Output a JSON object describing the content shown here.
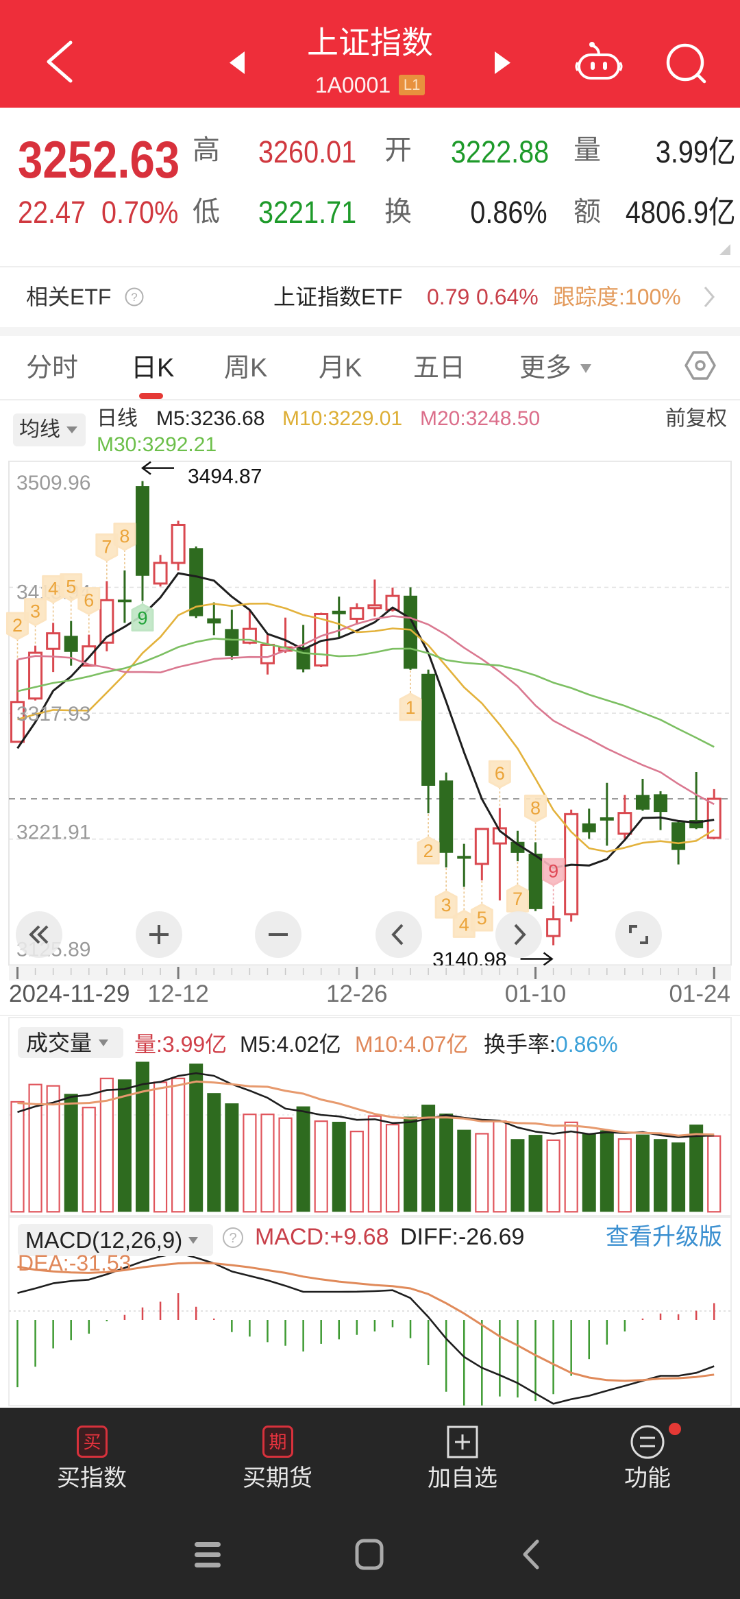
{
  "header": {
    "title": "上证指数",
    "code": "1A0001",
    "level_badge": "L1"
  },
  "quote": {
    "price": "3252.63",
    "change": "22.47",
    "change_pct": "0.70%",
    "high_label": "高",
    "high": "3260.01",
    "open_label": "开",
    "open": "3222.88",
    "volume_label": "量",
    "volume": "3.99亿",
    "low_label": "低",
    "low": "3221.71",
    "turnover_label": "换",
    "turnover": "0.86%",
    "amount_label": "额",
    "amount": "4806.9亿"
  },
  "etf": {
    "section_label": "相关ETF",
    "name": "上证指数ETF",
    "price": "0.79",
    "change_pct": "0.64%",
    "tracking": "跟踪度:100%"
  },
  "tabs": {
    "items": [
      {
        "label": "分时",
        "active": false
      },
      {
        "label": "日K",
        "active": true
      },
      {
        "label": "周K",
        "active": false
      },
      {
        "label": "月K",
        "active": false
      },
      {
        "label": "五日",
        "active": false
      },
      {
        "label": "更多",
        "active": false
      }
    ]
  },
  "kline_legend": {
    "indicator_select": "均线",
    "period": "日线",
    "ma5": "M5:3236.68",
    "ma10": "M10:3229.01",
    "ma20": "M20:3248.50",
    "ma30": "M30:3292.21",
    "adjust_mode": "前复权"
  },
  "chart_controls": [
    {
      "icon": "double-chevron-left-icon",
      "action": "jump-to-start"
    },
    {
      "icon": "plus-icon",
      "action": "zoom-in"
    },
    {
      "icon": "minus-icon",
      "action": "zoom-out"
    },
    {
      "icon": "chevron-left-icon",
      "action": "scroll-left"
    },
    {
      "icon": "chevron-right-icon",
      "action": "scroll-right"
    },
    {
      "icon": "fullscreen-icon",
      "action": "fullscreen"
    }
  ],
  "volume_legend": {
    "select": "成交量",
    "volume": "量:3.99亿",
    "ma5": "M5:4.02亿",
    "ma10": "M10:4.07亿",
    "turnover_label": "换手率:",
    "turnover_value": "0.86%"
  },
  "macd_legend": {
    "select": "MACD(12,26,9)",
    "macd": "MACD:+9.68",
    "diff": "DIFF:-26.69",
    "dea": "DEA:-31.53",
    "upgrade_link": "查看升级版"
  },
  "bottom_nav": [
    {
      "label": "买指数",
      "glyph": "买",
      "icon": "buy-index-icon"
    },
    {
      "label": "买期货",
      "glyph": "期",
      "icon": "buy-futures-icon"
    },
    {
      "label": "加自选",
      "icon": "add-watchlist-icon"
    },
    {
      "label": "功能",
      "icon": "functions-menu-icon",
      "badge_dot": true
    }
  ],
  "system_nav": [
    "recents-icon",
    "home-icon",
    "back-icon"
  ],
  "colors": {
    "brand_red": "#EE2E3A",
    "up": "#D9484F",
    "down": "#2E6B1F",
    "up_text": "#D0383F",
    "down_text": "#1E9A2A",
    "link_blue": "#3A8FD0",
    "tracking_orange": "#E39A5B"
  },
  "chart_data": [
    {
      "id": "kline",
      "type": "bar",
      "variant": "candlestick",
      "title": "日线",
      "xlabel": "",
      "ylabel": "",
      "ylim": [
        3125.89,
        3509.96
      ],
      "y_ticks": [
        3509.96,
        3413.94,
        3317.93,
        3221.91,
        3125.89
      ],
      "x_tick_labels": [
        {
          "index": 0,
          "label": "2024-11-29"
        },
        {
          "index": 9,
          "label": "12-12"
        },
        {
          "index": 19,
          "label": "12-26"
        },
        {
          "index": 29,
          "label": "01-10"
        },
        {
          "index": 39,
          "label": "01-24"
        }
      ],
      "grid": true,
      "last_price": 3252.63,
      "ohlc_fields": [
        "open",
        "high",
        "low",
        "close"
      ],
      "ohlc": [
        [
          3296.1,
          3358.7,
          3295.5,
          3326.46
        ],
        [
          3329.1,
          3369.4,
          3327.6,
          3363.98
        ],
        [
          3367.0,
          3386.8,
          3349.3,
          3378.81
        ],
        [
          3376.9,
          3388.2,
          3354.2,
          3364.65
        ],
        [
          3354.2,
          3377.8,
          3353.5,
          3368.86
        ],
        [
          3371.7,
          3418.6,
          3365.1,
          3404.08
        ],
        [
          3404.5,
          3426.8,
          3386.8,
          3402.53
        ],
        [
          3491.0,
          3494.87,
          3403.5,
          3422.66
        ],
        [
          3416.8,
          3438.6,
          3414.5,
          3432.49
        ],
        [
          3432.5,
          3464.6,
          3426.8,
          3461.5
        ],
        [
          3443.8,
          3445.0,
          3390.5,
          3391.88
        ],
        [
          3390.2,
          3402.4,
          3377.4,
          3386.33
        ],
        [
          3382.1,
          3396.8,
          3358.7,
          3361.49
        ],
        [
          3371.7,
          3396.8,
          3370.5,
          3382.21
        ],
        [
          3356.0,
          3378.6,
          3347.4,
          3370.03
        ],
        [
          3365.6,
          3390.8,
          3363.9,
          3368.07
        ],
        [
          3368.2,
          3385.2,
          3349.1,
          3351.26
        ],
        [
          3354.3,
          3394.5,
          3353.0,
          3393.53
        ],
        [
          3396.0,
          3406.8,
          3376.0,
          3393.35
        ],
        [
          3389.9,
          3401.7,
          3385.5,
          3398.08
        ],
        [
          3398.1,
          3419.8,
          3391.6,
          3400.14
        ],
        [
          3396.8,
          3413.7,
          3395.5,
          3407.33
        ],
        [
          3407.5,
          3413.9,
          3351.0,
          3351.76
        ],
        [
          3347.9,
          3351.1,
          3241.6,
          3262.56
        ],
        [
          3266.6,
          3272.7,
          3200.3,
          3211.43
        ],
        [
          3209.1,
          3218.3,
          3185.5,
          3206.92
        ],
        [
          3203.0,
          3230.0,
          3190.4,
          3229.64
        ],
        [
          3218.6,
          3245.7,
          3175.1,
          3230.17
        ],
        [
          3219.8,
          3228.2,
          3205.0,
          3211.39
        ],
        [
          3210.8,
          3219.5,
          3167.0,
          3168.52
        ],
        [
          3148.0,
          3171.2,
          3140.98,
          3160.76
        ],
        [
          3164.6,
          3244.4,
          3159.0,
          3240.94
        ],
        [
          3233.9,
          3245.1,
          3222.1,
          3227.12
        ],
        [
          3238.5,
          3264.8,
          3216.9,
          3236.03
        ],
        [
          3226.0,
          3255.6,
          3222.1,
          3241.82
        ],
        [
          3255.6,
          3267.8,
          3243.5,
          3244.38
        ],
        [
          3256.1,
          3258.4,
          3228.8,
          3242.62
        ],
        [
          3234.7,
          3235.5,
          3202.6,
          3213.62
        ],
        [
          3236.4,
          3273.0,
          3229.5,
          3230.16
        ],
        [
          3222.88,
          3260.01,
          3221.71,
          3252.63
        ]
      ],
      "series": [
        {
          "name": "M5",
          "color": "#1E1E1E",
          "values": [
            3291.09,
            3311.14,
            3334.95,
            3345.92,
            3360.55,
            3376.08,
            3383.79,
            3392.56,
            3406.12,
            3424.65,
            3422.21,
            3418.97,
            3406.74,
            3396.68,
            3378.39,
            3373.63,
            3366.61,
            3373.02,
            3375.25,
            3380.86,
            3387.27,
            3398.49,
            3390.13,
            3363.97,
            3326.64,
            3288.0,
            3252.46,
            3228.14,
            3217.91,
            3209.33,
            3200.1,
            3202.36,
            3201.75,
            3206.67,
            3221.33,
            3238.06,
            3238.39,
            3235.69,
            3234.52,
            3236.68
          ]
        },
        {
          "name": "M10",
          "color": "#E3B23C",
          "values": [
            3313.09,
            3317.1,
            3320.38,
            3320.05,
            3319.9,
            3333.58,
            3347.46,
            3363.75,
            3376.02,
            3392.6,
            3399.14,
            3401.38,
            3399.65,
            3401.4,
            3401.52,
            3397.92,
            3392.79,
            3389.88,
            3385.97,
            3379.62,
            3380.45,
            3382.55,
            3381.58,
            3369.61,
            3353.75,
            3337.64,
            3325.47,
            3309.14,
            3290.94,
            3267.99,
            3244.05,
            3227.41,
            3214.95,
            3212.29,
            3215.33,
            3219.08,
            3220.38,
            3218.72,
            3220.6,
            3229.01
          ]
        },
        {
          "name": "M20",
          "color": "#DA7890",
          "values": [
            3358.83,
            3361.51,
            3361.11,
            3360.15,
            3355.09,
            3352.68,
            3349.28,
            3349.32,
            3348.98,
            3353.06,
            3356.12,
            3359.24,
            3360.02,
            3360.73,
            3360.71,
            3365.75,
            3370.13,
            3376.82,
            3380.99,
            3386.11,
            3389.8,
            3391.96,
            3390.61,
            3385.51,
            3377.64,
            3367.78,
            3359.13,
            3349.51,
            3338.45,
            3323.8,
            3312.25,
            3304.98,
            3298.26,
            3290.95,
            3284.54,
            3278.36,
            3272.92,
            3263.93,
            3255.77,
            3248.5
          ]
        },
        {
          "name": "M30",
          "color": "#7CBF62",
          "values": [
            3334.66,
            3337.86,
            3340.96,
            3343.02,
            3345.97,
            3349.45,
            3352.13,
            3356.67,
            3362.21,
            3368.27,
            3372.27,
            3374.8,
            3373.95,
            3373.9,
            3370.56,
            3367.76,
            3363.79,
            3362.84,
            3361.31,
            3361.91,
            3364.23,
            3367.01,
            3367.2,
            3363.69,
            3358.39,
            3356.38,
            3355.24,
            3354.26,
            3350.98,
            3346.74,
            3341.21,
            3337.11,
            3332.06,
            3327.77,
            3323.53,
            3318.21,
            3312.88,
            3305.91,
            3299.17,
            3292.21
          ]
        }
      ],
      "td_labels": [
        {
          "index": 0,
          "text": "2",
          "position": "above",
          "tone": "count"
        },
        {
          "index": 1,
          "text": "3",
          "position": "above",
          "tone": "count"
        },
        {
          "index": 2,
          "text": "4",
          "position": "above",
          "tone": "count"
        },
        {
          "index": 3,
          "text": "5",
          "position": "above",
          "tone": "count"
        },
        {
          "index": 4,
          "text": "6",
          "position": "above",
          "tone": "count"
        },
        {
          "index": 5,
          "text": "7",
          "position": "above",
          "tone": "count"
        },
        {
          "index": 6,
          "text": "8",
          "position": "above",
          "tone": "count"
        },
        {
          "index": 7,
          "text": "9",
          "position": "below",
          "tone": "green"
        },
        {
          "index": 22,
          "text": "1",
          "position": "below",
          "tone": "count"
        },
        {
          "index": 23,
          "text": "2",
          "position": "below",
          "tone": "count"
        },
        {
          "index": 24,
          "text": "3",
          "position": "below",
          "tone": "count"
        },
        {
          "index": 25,
          "text": "4",
          "position": "below",
          "tone": "count"
        },
        {
          "index": 26,
          "text": "5",
          "position": "below",
          "tone": "count"
        },
        {
          "index": 27,
          "text": "6",
          "position": "above",
          "tone": "count"
        },
        {
          "index": 28,
          "text": "7",
          "position": "below",
          "tone": "count"
        },
        {
          "index": 29,
          "text": "8",
          "position": "above",
          "tone": "count"
        },
        {
          "index": 30,
          "text": "9",
          "position": "above",
          "tone": "red"
        }
      ],
      "annotations": [
        {
          "index": 7,
          "text": "3494.87",
          "arrow": "left",
          "anchor": "high"
        },
        {
          "index": 30,
          "text": "3140.98",
          "arrow": "right",
          "anchor": "low"
        }
      ]
    },
    {
      "id": "volume",
      "type": "bar",
      "title": "成交量",
      "unit": "亿",
      "values": [
        5.79,
        6.7,
        6.63,
        6.21,
        5.49,
        7.02,
        6.97,
        7.9,
        6.82,
        7.02,
        7.8,
        6.25,
        5.71,
        5.13,
        5.13,
        4.93,
        5.55,
        4.77,
        4.74,
        4.23,
        5.04,
        4.59,
        5.01,
        5.64,
        5.17,
        4.32,
        4.11,
        4.77,
        3.83,
        4.05,
        3.77,
        4.71,
        4.11,
        4.29,
        3.83,
        4.07,
        3.83,
        3.65,
        4.59,
        3.99
      ],
      "series": [
        {
          "name": "M5",
          "color": "#1E1E1E",
          "values": [
            5.25,
            5.55,
            5.75,
            6.05,
            6.16,
            6.41,
            6.46,
            6.72,
            6.84,
            7.15,
            7.3,
            7.16,
            6.72,
            6.38,
            6.0,
            5.43,
            5.29,
            5.1,
            5.02,
            4.84,
            4.87,
            4.67,
            4.72,
            4.9,
            5.09,
            4.95,
            4.85,
            4.8,
            4.44,
            4.22,
            4.11,
            4.23,
            4.09,
            4.19,
            4.14,
            4.2,
            4.03,
            3.93,
            3.99,
            4.02
          ]
        },
        {
          "name": "M10",
          "color": "#E79A6E",
          "values": [
            5.73,
            5.67,
            5.65,
            5.7,
            5.73,
            5.85,
            6.09,
            6.33,
            6.51,
            6.66,
            6.86,
            6.81,
            6.72,
            6.61,
            6.58,
            6.37,
            6.22,
            5.91,
            5.7,
            5.42,
            5.15,
            4.98,
            4.91,
            4.96,
            4.97,
            4.91,
            4.76,
            4.76,
            4.67,
            4.65,
            4.53,
            4.54,
            4.45,
            4.31,
            4.18,
            4.15,
            4.13,
            4.01,
            4.09,
            4.07
          ]
        }
      ]
    },
    {
      "id": "macd",
      "type": "bar",
      "title": "MACD(12,26,9)",
      "values": [
        -38.8,
        -27.0,
        -16.4,
        -11.6,
        -7.9,
        -0.5,
        2.9,
        7.2,
        10.5,
        15.4,
        7.6,
        0.6,
        -7.0,
        -9.6,
        -12.8,
        -14.9,
        -18.2,
        -13.8,
        -11.2,
        -8.6,
        -6.6,
        -4.2,
        -10.5,
        -26.1,
        -41.4,
        -49.3,
        -49.3,
        -44.1,
        -44.7,
        -46.7,
        -42.8,
        -32.2,
        -22.6,
        -14.2,
        -6.6,
        0.3,
        3.7,
        3.3,
        5.3,
        9.68
      ],
      "series": [
        {
          "name": "DIFF",
          "color": "#1E1E1E",
          "values": [
            15.5,
            18.2,
            21.1,
            22.4,
            23.2,
            26.3,
            30.0,
            33.7,
            36.6,
            38.6,
            35.9,
            32.6,
            28.0,
            25.4,
            22.8,
            19.7,
            16.2,
            16.2,
            16.2,
            16.3,
            16.6,
            17.1,
            12.6,
            1.7,
            -10.8,
            -21.3,
            -27.6,
            -31.8,
            -36.4,
            -42.4,
            -48.3,
            -45.7,
            -43.7,
            -40.8,
            -38.0,
            -35.1,
            -32.2,
            -32.2,
            -30.5,
            -26.69
          ]
        },
        {
          "name": "DEA",
          "color": "#E08A5A",
          "values": [
            30.7,
            28.9,
            28.0,
            27.4,
            27.1,
            27.6,
            28.7,
            30.3,
            31.6,
            32.6,
            32.9,
            32.6,
            31.6,
            30.3,
            28.7,
            27.1,
            25.0,
            23.4,
            22.1,
            21.1,
            20.1,
            19.5,
            18.2,
            14.9,
            9.6,
            3.7,
            -2.9,
            -9.5,
            -14.7,
            -20.3,
            -25.5,
            -30.5,
            -33.2,
            -34.7,
            -35.1,
            -34.7,
            -33.8,
            -33.6,
            -32.9,
            -31.53
          ]
        }
      ]
    }
  ]
}
